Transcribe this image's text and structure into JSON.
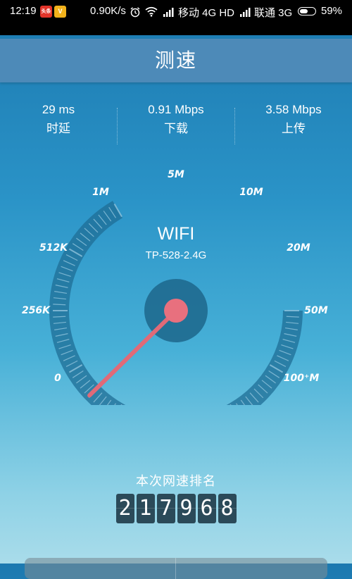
{
  "status_bar": {
    "time": "12:19",
    "badge_news": "头条",
    "badge_v": "V",
    "net_speed": "0.90K/s",
    "carrier1": "移动 4G HD",
    "carrier2": "联通 3G",
    "battery": "59%",
    "battery_level": 0.59
  },
  "header": {
    "title": "测速"
  },
  "stats": [
    {
      "value": "29 ms",
      "label": "时延"
    },
    {
      "value": "0.91 Mbps",
      "label": "下载"
    },
    {
      "value": "3.58 Mbps",
      "label": "上传"
    }
  ],
  "gauge": {
    "network_type": "WIFI",
    "ssid": "TP-528-2.4G",
    "scale_labels": [
      "0",
      "256K",
      "512K",
      "1M",
      "5M",
      "10M",
      "20M",
      "50M",
      "100⁺M"
    ],
    "needle_position": 0.06
  },
  "ranking": {
    "label": "本次网速排名",
    "digits": [
      "2",
      "1",
      "7",
      "9",
      "6",
      "8"
    ]
  },
  "colors": {
    "accent_needle": "#e06a78",
    "gauge_track": "#1f6e96",
    "gauge_ticks": "#8fc3dc"
  }
}
